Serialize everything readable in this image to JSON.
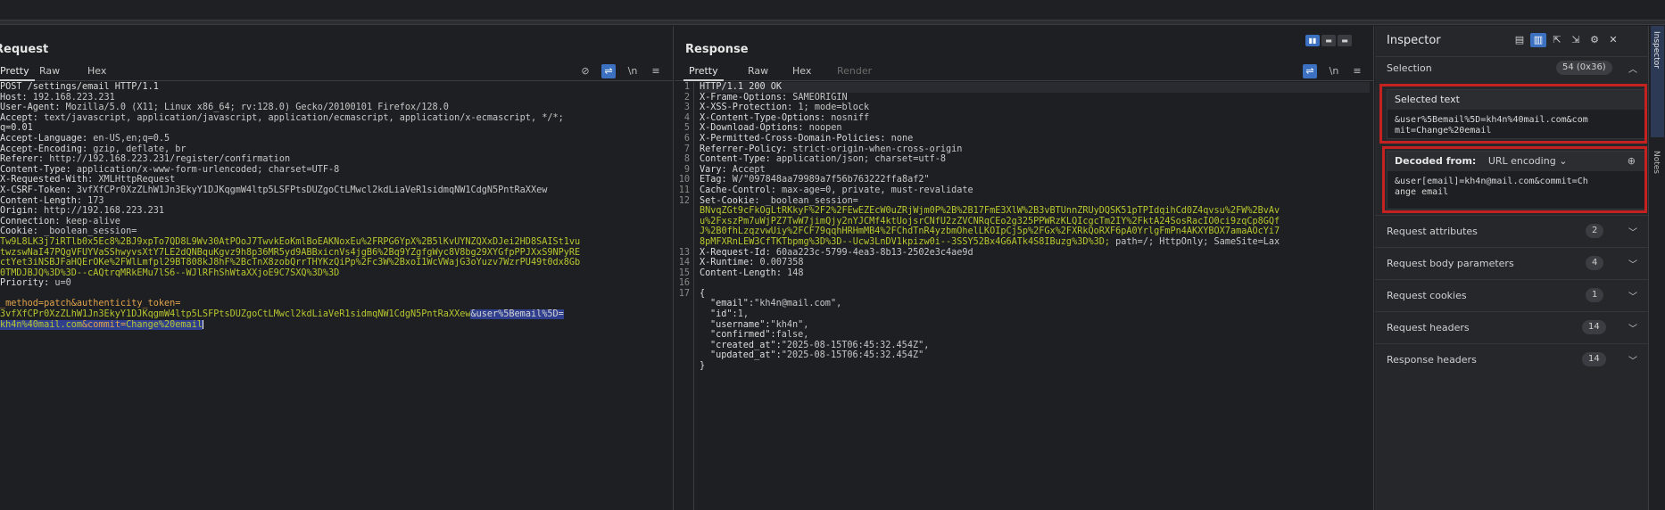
{
  "request": {
    "title": "Request",
    "tabs": [
      "Pretty",
      "Raw",
      "Hex"
    ],
    "tool_wrap": "\\n",
    "tool_menu": "≡",
    "lines": [
      {
        "k": "POST /settings/email HTTP/1.1",
        "v": ""
      },
      {
        "k": "Host:",
        "v": " 192.168.223.231"
      },
      {
        "k": "User-Agent:",
        "v": " Mozilla/5.0 (X11; Linux x86_64; rv:128.0) Gecko/20100101 Firefox/128.0"
      },
      {
        "k": "Accept:",
        "v": " text/javascript, application/javascript, application/ecmascript, application/x-ecmascript, */*;"
      },
      {
        "k": "q=0.01",
        "v": ""
      },
      {
        "k": "Accept-Language:",
        "v": " en-US,en;q=0.5"
      },
      {
        "k": "Accept-Encoding:",
        "v": " gzip, deflate, br"
      },
      {
        "k": "Referer:",
        "v": " http://192.168.223.231/register/confirmation"
      },
      {
        "k": "Content-Type:",
        "v": " application/x-www-form-urlencoded; charset=UTF-8"
      },
      {
        "k": "X-Requested-With:",
        "v": " XMLHttpRequest"
      },
      {
        "k": "X-CSRF-Token:",
        "v": " 3vfXfCPr0XzZLhW1Jn3EkyY1DJKqgmW4ltp5LSFPtsDUZgoCtLMwcl2kdLiaVeR1sidmqNW1CdgN5PntRaXXew"
      },
      {
        "k": "Content-Length:",
        "v": " 173"
      },
      {
        "k": "Origin:",
        "v": " http://192.168.223.231"
      },
      {
        "k": "Connection:",
        "v": " keep-alive"
      },
      {
        "k": "Cookie:",
        "v": " _boolean_session="
      }
    ],
    "cookie_lines": [
      "Tw9L8LK3j7iRTlb0x5Ec8%2BJ9xpTo7QD8L9Wv30AtPOoJ7TwvkEoKmlBoEAKNoxEu%2FRPG6YpX%2B5lKvUYNZQXxDJei2HD8SAISt1vu",
      "twzswNaI47PQgVFUYVaSShwyvsXtY7LE2dQNBquKgvz9h8p36MR5yd9ABBxicnVs4jgB6%2Bq9YZgfgWyc8V8bg29XYGfpPPJXxS9NPyRE",
      "ctYet3iNSBJFaHQErOKe%2FWlLmfpl29BT808kJ8hF%2BcTnX8zobQrrTHYKzQiPp%2Fc3W%2BxoI1WcVWajG3oYuzv7WzrPU49t0dx8Gb",
      "0TMDJBJQ%3D%3D--cAQtrqMRkEMu7lS6--WJlRFhShWtaXXjoE9C7SXQ%3D%3D"
    ],
    "priority": {
      "k": "Priority:",
      "v": " u=0"
    },
    "body": {
      "line1_prefix": "_method=patch&authenticity_token=",
      "line2_token": "3vfXfCPr0XzZLhW1Jn3EkyY1DJKqgmW4ltp5LSFPtsDUZgoCtLMwcl2kdLiaVeR1sidmqNW1CdgN5PntRaXXew",
      "line2_sel": "&user%5Bemail%5D=",
      "line3_val": "kh4n%40mail.com",
      "line3_commit_key": "&commit=",
      "line3_commit_val": "Change%20email"
    }
  },
  "response": {
    "title": "Response",
    "tabs": [
      "Pretty",
      "Raw",
      "Hex",
      "Render"
    ],
    "tool_wrap": "\\n",
    "tool_menu": "≡",
    "lines": [
      {
        "n": "1",
        "k": "HTTP/1.1 200 OK",
        "v": ""
      },
      {
        "n": "2",
        "k": "X-Frame-Options:",
        "v": " SAMEORIGIN"
      },
      {
        "n": "3",
        "k": "X-XSS-Protection:",
        "v": " 1; mode=block"
      },
      {
        "n": "4",
        "k": "X-Content-Type-Options:",
        "v": " nosniff"
      },
      {
        "n": "5",
        "k": "X-Download-Options:",
        "v": " noopen"
      },
      {
        "n": "6",
        "k": "X-Permitted-Cross-Domain-Policies:",
        "v": " none"
      },
      {
        "n": "7",
        "k": "Referrer-Policy:",
        "v": " strict-origin-when-cross-origin"
      },
      {
        "n": "8",
        "k": "Content-Type:",
        "v": " application/json; charset=utf-8"
      },
      {
        "n": "9",
        "k": "Vary:",
        "v": " Accept"
      },
      {
        "n": "10",
        "k": "ETag:",
        "v": " W/\"097848aa79989a7f56b763222ffa8af2\""
      },
      {
        "n": "11",
        "k": "Cache-Control:",
        "v": " max-age=0, private, must-revalidate"
      },
      {
        "n": "12",
        "k": "Set-Cookie:",
        "v": " _boolean_session="
      }
    ],
    "cookie_lines": [
      "BNvqZGt9cFkOgLtRKkyF%2F2%2FEwEZEcW0uZRjWjm0P%2B%2B17FmE3XlW%2B3vBTUnnZRUyDQSK51pTPIdqihCd0Z4qvsu%2FW%2BvAv",
      "u%2FxszPm7uWjPZ7TwW7jimQjy2nYJCMf4ktUojsrCNfU2zZVCNRqCEo2g325PPWRzKLQIcgcTm2IY%2FktA24SosRacIO0ci9zqCp8GQf",
      "J%2B0fhLzqzvwUiy%2FCF79qqhHRHmMB4%2FChdTnR4yzbmOhelLKOIpCj5p%2FGx%2FXRkQoRXF6pA0YrlgFmPn4AKXYBOX7amaAOcYi7",
      "8pMFXRnLEW3CfTKTbpmg%3D%3D--Ucw3LnDV1kpizw0i--3SSY52Bx4G6ATk4S8IBuzg%3D%3D;"
    ],
    "cookie_tail": " path=/; HttpOnly; SameSite=Lax",
    "after_lines": [
      {
        "n": "13",
        "k": "X-Request-Id:",
        "v": " 60aa223c-5799-4ea3-8b13-2502e3c4ae9d"
      },
      {
        "n": "14",
        "k": "X-Runtime:",
        "v": " 0.007358"
      },
      {
        "n": "15",
        "k": "Content-Length:",
        "v": " 148"
      }
    ],
    "json_lines": [
      {
        "key": "\"email\"",
        "val": "\"kh4n@mail.com\","
      },
      {
        "key": "\"id\"",
        "val": "1,"
      },
      {
        "key": "\"username\"",
        "val": "\"kh4n\","
      },
      {
        "key": "\"confirmed\"",
        "val": "false,"
      },
      {
        "key": "\"created_at\"",
        "val": "\"2025-08-15T06:45:32.454Z\","
      },
      {
        "key": "\"updated_at\"",
        "val": "\"2025-08-15T06:45:32.454Z\""
      }
    ],
    "brace_open": "{",
    "brace_close": "}",
    "n16": "16",
    "n17": "17"
  },
  "inspector": {
    "title": "Inspector",
    "selection_label": "Selection",
    "selection_badge": "54 (0x36)",
    "selected_text_head": "Selected text",
    "selected_text_value": "&user%5Bemail%5D=kh4n%40mail.com&com\nmit=Change%20email",
    "decoded_from_label": "Decoded from:",
    "decoded_from_value": "URL encoding",
    "decoded_value": "&user[email]=kh4n@mail.com&commit=Ch\nange email",
    "sections": [
      {
        "label": "Request attributes",
        "count": "2"
      },
      {
        "label": "Request body parameters",
        "count": "4"
      },
      {
        "label": "Request cookies",
        "count": "1"
      },
      {
        "label": "Request headers",
        "count": "14"
      },
      {
        "label": "Response headers",
        "count": "14"
      }
    ]
  },
  "side_tabs": {
    "inspector": "Inspector",
    "notes": "Notes"
  },
  "colors": {
    "accent": "#3c70c0",
    "highlight_frame": "#c42121",
    "cookie_value": "#b8c72f",
    "selection": "#2f3f8d"
  }
}
